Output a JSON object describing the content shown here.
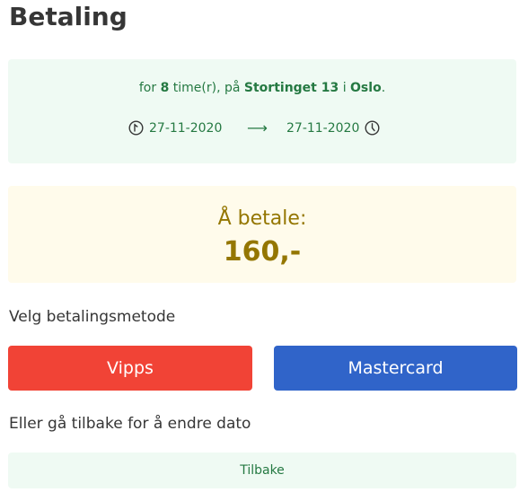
{
  "page": {
    "title": "Betaling"
  },
  "booking": {
    "prefix": "for",
    "hours": "8",
    "hours_suffix": "time(r), på",
    "address": "Stortinget 13",
    "city_prefix": "i",
    "city": "Oslo",
    "period_end": ".",
    "start_date": "27-11-2020",
    "arrow": "⟶",
    "end_date": "27-11-2020"
  },
  "payment": {
    "label": "Å betale:",
    "amount": "160,-"
  },
  "methods": {
    "label": "Velg betalingsmetode",
    "vipps": "Vipps",
    "mastercard": "Mastercard"
  },
  "back": {
    "text": "Eller gå tilbake for å endre dato",
    "button": "Tilbake"
  },
  "colors": {
    "success_bg": "#effaf3",
    "success_text": "#257942",
    "warning_bg": "#fffbeb",
    "warning_text": "#947600",
    "vipps": "#f14336",
    "mastercard": "#3064c9"
  },
  "icons": {
    "start": "clock-start-icon",
    "end": "clock-end-icon"
  }
}
